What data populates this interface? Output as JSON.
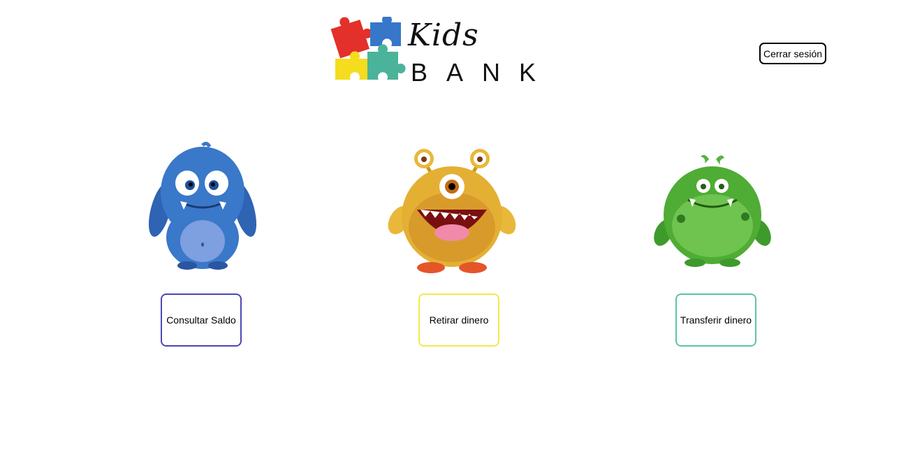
{
  "header": {
    "logo": {
      "line1": "Kids",
      "line2": "BANK",
      "puzzle_colors": [
        "#e4302a",
        "#3677c9",
        "#f5dc1e",
        "#4bb39a"
      ]
    },
    "logout_label": "Cerrar sesión"
  },
  "actions": [
    {
      "label": "Consultar Saldo",
      "border_color": "#4b47b4",
      "monster": "blue-monster"
    },
    {
      "label": "Retirar dinero",
      "border_color": "#f3e84a",
      "monster": "yellow-monster"
    },
    {
      "label": "Transferir dinero",
      "border_color": "#5cc59b",
      "monster": "green-monster"
    }
  ]
}
